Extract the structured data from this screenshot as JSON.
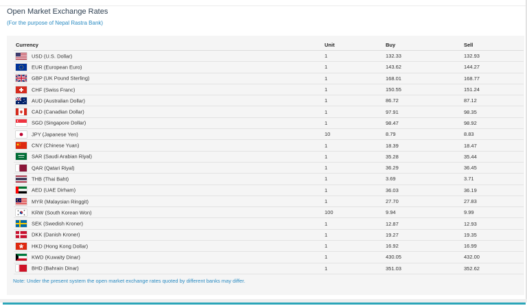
{
  "header": {
    "title": "Open Market Exchange Rates",
    "subtitle": "(For the purpose of Nepal Rastra Bank)"
  },
  "table": {
    "columns": {
      "currency": "Currency",
      "unit": "Unit",
      "buy": "Buy",
      "sell": "Sell"
    },
    "rows": [
      {
        "label": "USD (U.S. Dollar)",
        "unit": "1",
        "buy": "132.33",
        "sell": "132.93",
        "flag": "usd-flag-icon"
      },
      {
        "label": "EUR (European Euro)",
        "unit": "1",
        "buy": "143.62",
        "sell": "144.27",
        "flag": "eur-flag-icon"
      },
      {
        "label": "GBP (UK Pound Sterling)",
        "unit": "1",
        "buy": "168.01",
        "sell": "168.77",
        "flag": "gbp-flag-icon"
      },
      {
        "label": "CHF (Swiss Franc)",
        "unit": "1",
        "buy": "150.55",
        "sell": "151.24",
        "flag": "chf-flag-icon"
      },
      {
        "label": "AUD (Australian Dollar)",
        "unit": "1",
        "buy": "86.72",
        "sell": "87.12",
        "flag": "aud-flag-icon"
      },
      {
        "label": "CAD (Canadian Dollar)",
        "unit": "1",
        "buy": "97.91",
        "sell": "98.35",
        "flag": "cad-flag-icon"
      },
      {
        "label": "SGD (Singapore Dollar)",
        "unit": "1",
        "buy": "98.47",
        "sell": "98.92",
        "flag": "sgd-flag-icon"
      },
      {
        "label": "JPY (Japanese Yen)",
        "unit": "10",
        "buy": "8.79",
        "sell": "8.83",
        "flag": "jpy-flag-icon"
      },
      {
        "label": "CNY (Chinese Yuan)",
        "unit": "1",
        "buy": "18.39",
        "sell": "18.47",
        "flag": "cny-flag-icon"
      },
      {
        "label": "SAR (Saudi Arabian Riyal)",
        "unit": "1",
        "buy": "35.28",
        "sell": "35.44",
        "flag": "sar-flag-icon"
      },
      {
        "label": "QAR (Qatari Riyal)",
        "unit": "1",
        "buy": "36.29",
        "sell": "36.45",
        "flag": "qar-flag-icon"
      },
      {
        "label": "THB (Thai Baht)",
        "unit": "1",
        "buy": "3.69",
        "sell": "3.71",
        "flag": "thb-flag-icon"
      },
      {
        "label": "AED (UAE Dirham)",
        "unit": "1",
        "buy": "36.03",
        "sell": "36.19",
        "flag": "aed-flag-icon"
      },
      {
        "label": "MYR (Malaysian Ringgit)",
        "unit": "1",
        "buy": "27.70",
        "sell": "27.83",
        "flag": "myr-flag-icon"
      },
      {
        "label": "KRW (South Korean Won)",
        "unit": "100",
        "buy": "9.94",
        "sell": "9.99",
        "flag": "krw-flag-icon"
      },
      {
        "label": "SEK (Swedish Kroner)",
        "unit": "1",
        "buy": "12.87",
        "sell": "12.93",
        "flag": "sek-flag-icon"
      },
      {
        "label": "DKK (Danish Kroner)",
        "unit": "1",
        "buy": "19.27",
        "sell": "19.35",
        "flag": "dkk-flag-icon"
      },
      {
        "label": "HKD (Hong Kong Dollar)",
        "unit": "1",
        "buy": "16.92",
        "sell": "16.99",
        "flag": "hkd-flag-icon"
      },
      {
        "label": "KWD (Kuwaity Dinar)",
        "unit": "1",
        "buy": "430.05",
        "sell": "432.00",
        "flag": "kwd-flag-icon"
      },
      {
        "label": "BHD (Bahrain Dinar)",
        "unit": "1",
        "buy": "351.03",
        "sell": "352.62",
        "flag": "bhd-flag-icon"
      }
    ]
  },
  "note": "Note: Under the present system the open market exchange rates quoted by different banks may differ.",
  "colors": {
    "title": "#2c3e50",
    "link_blue": "#2a8bc2",
    "table_bg": "#f5f5f5",
    "accent_bar": "#2ba5b8"
  }
}
